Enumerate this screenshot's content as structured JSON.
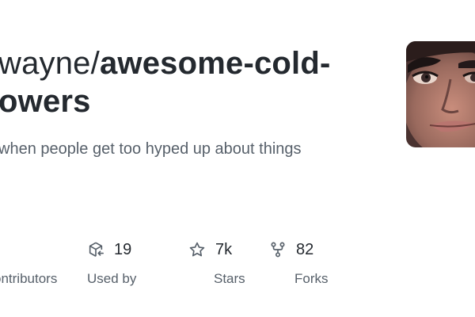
{
  "repo": {
    "owner_fragment": "wayne/",
    "name_line1": "awesome-cold-",
    "name_line2": "owers",
    "description": "when people get too hyped up about things"
  },
  "stats": {
    "contributors": {
      "value": "",
      "label": "ontributors"
    },
    "used_by": {
      "value": "19",
      "label": "Used by",
      "icon": "package-dependents-icon"
    },
    "stars": {
      "value": "7k",
      "label": "Stars",
      "icon": "star-icon"
    },
    "forks": {
      "value": "82",
      "label": "Forks",
      "icon": "repo-forked-icon"
    }
  },
  "colors": {
    "title": "#24292f",
    "muted": "#57606a",
    "icon": "#57606a",
    "background": "#ffffff"
  }
}
